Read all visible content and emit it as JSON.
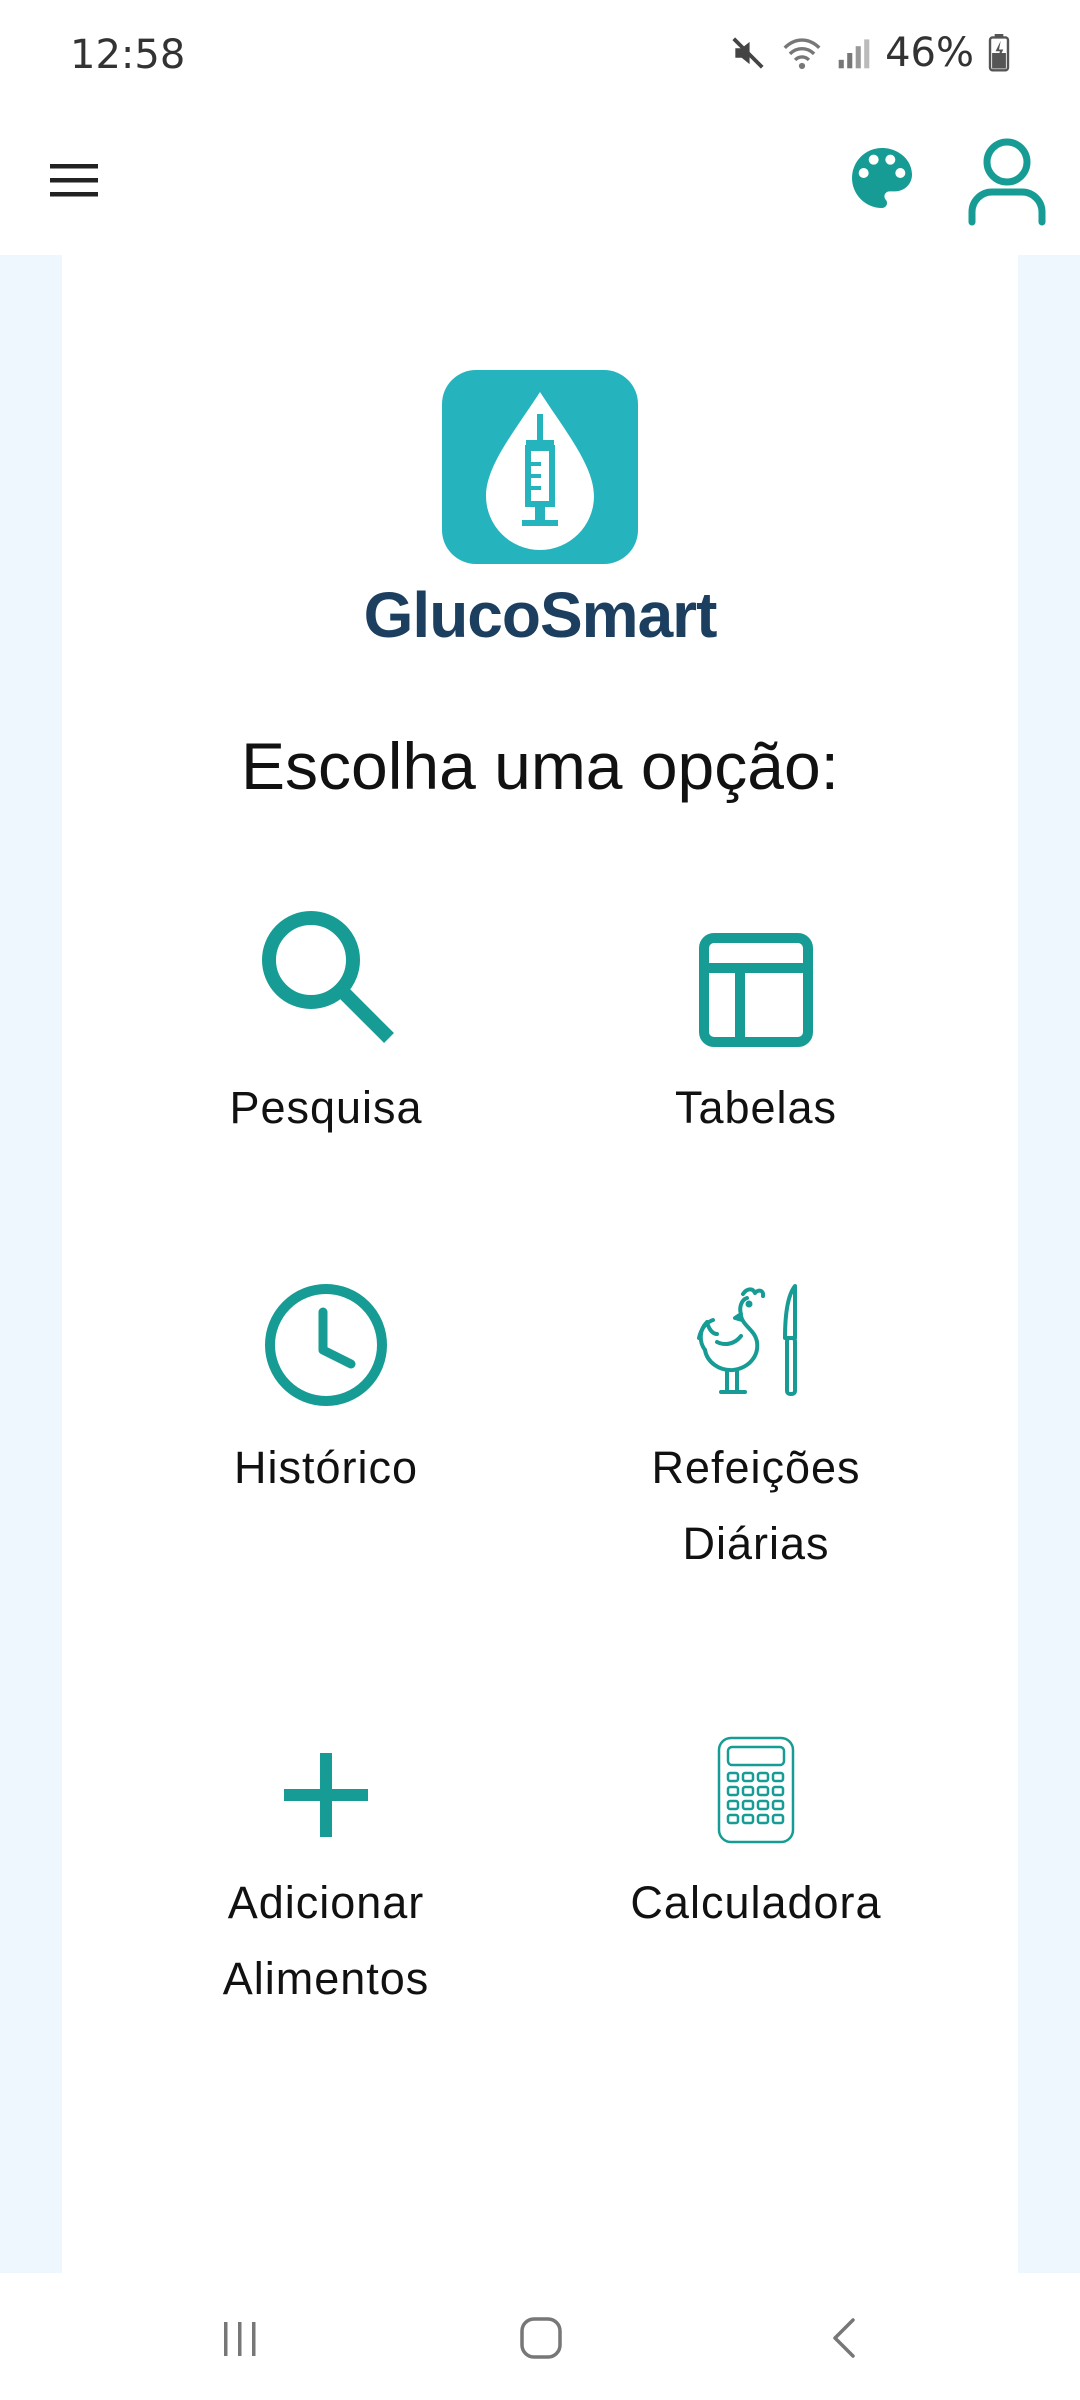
{
  "status_bar": {
    "time": "12:58",
    "battery_percent": "46%",
    "icons": [
      "mute-icon",
      "wifi-icon",
      "signal-icon",
      "battery-icon"
    ]
  },
  "app_bar": {
    "menu_icon": "hamburger-menu-icon",
    "palette_icon": "palette-icon",
    "account_icon": "user-icon"
  },
  "logo": {
    "name": "GlucoSmart",
    "icon": "blood-drop-syringe-icon"
  },
  "title": "Escolha uma opção:",
  "options": [
    {
      "label": "Pesquisa",
      "icon": "search-icon"
    },
    {
      "label": "Tabelas",
      "icon": "table-icon"
    },
    {
      "label": "Histórico",
      "icon": "clock-icon"
    },
    {
      "label": "Refeições Diárias",
      "icon": "rooster-knife-icon"
    },
    {
      "label": "Adicionar Alimentos",
      "icon": "plus-icon"
    },
    {
      "label": "Calculadora",
      "icon": "calculator-icon"
    }
  ],
  "colors": {
    "accent": "#169c94",
    "logo_bg": "#25b4be",
    "logo_text": "#1c3e5f",
    "side_tint": "#eef7fd"
  },
  "nav_bar": [
    "recent-apps-icon",
    "home-icon",
    "back-icon"
  ]
}
